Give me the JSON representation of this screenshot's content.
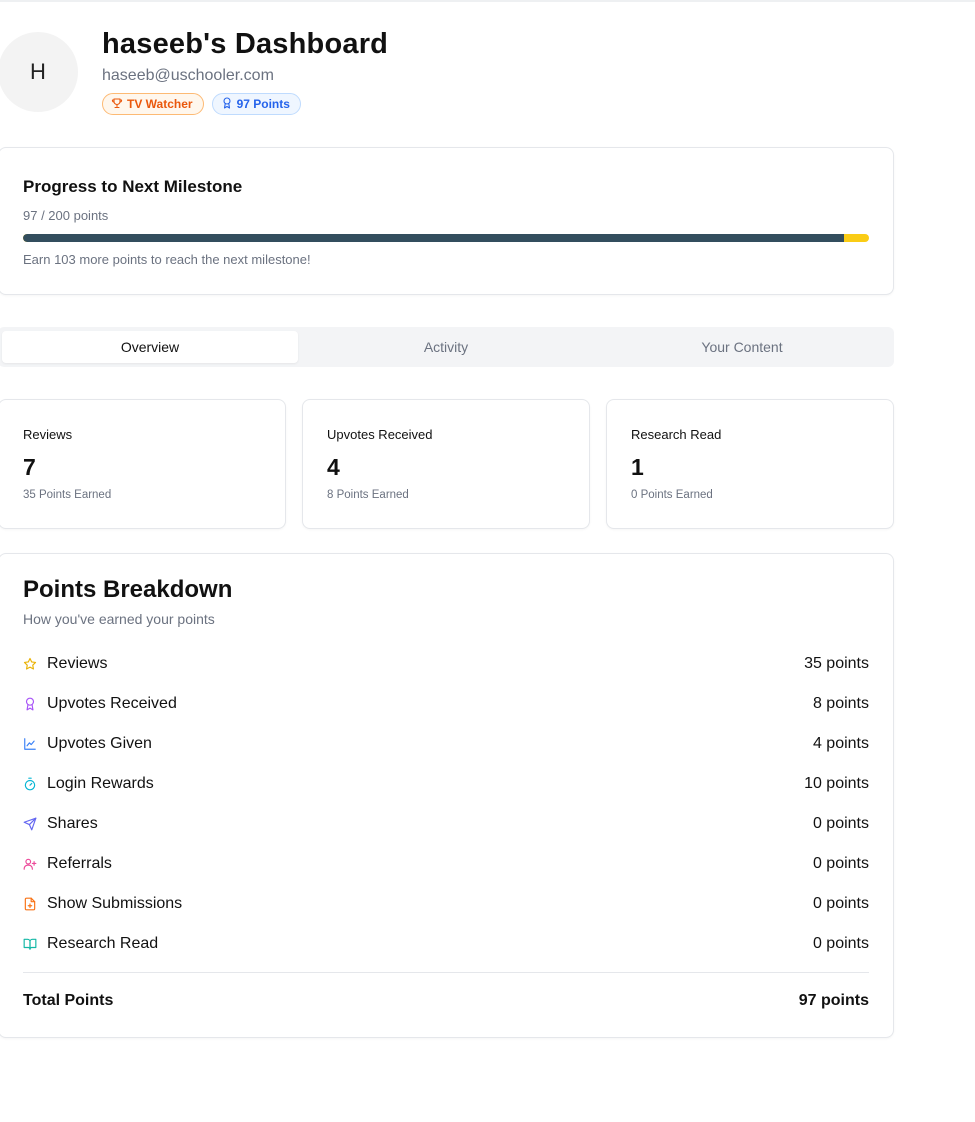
{
  "header": {
    "avatar_initial": "H",
    "title": "haseeb's Dashboard",
    "email": "haseeb@uschooler.com",
    "badges": [
      {
        "label": "TV Watcher",
        "icon": "trophy-icon",
        "color": "#ea580c"
      },
      {
        "label": "97 Points",
        "icon": "award-icon",
        "color": "#2563eb"
      }
    ]
  },
  "progress": {
    "title": "Progress to Next Milestone",
    "points_text": "97 / 200 points",
    "current": 97,
    "target": 200,
    "fraction": 0.97,
    "message": "Earn 103 more points to reach the next milestone!",
    "fill_color": "#334e5e",
    "track_color": "#facc15"
  },
  "tabs": [
    {
      "label": "Overview",
      "active": true
    },
    {
      "label": "Activity",
      "active": false
    },
    {
      "label": "Your Content",
      "active": false
    }
  ],
  "stats": [
    {
      "label": "Reviews",
      "value": "7",
      "sub": "35 Points Earned"
    },
    {
      "label": "Upvotes Received",
      "value": "4",
      "sub": "8 Points Earned"
    },
    {
      "label": "Research Read",
      "value": "1",
      "sub": "0 Points Earned"
    }
  ],
  "breakdown": {
    "title": "Points Breakdown",
    "subtitle": "How you've earned your points",
    "items": [
      {
        "name": "Reviews",
        "value": "35 points",
        "icon": "star-icon",
        "color": "#eab308"
      },
      {
        "name": "Upvotes Received",
        "value": "8 points",
        "icon": "award-icon",
        "color": "#a855f7"
      },
      {
        "name": "Upvotes Given",
        "value": "4 points",
        "icon": "trending-up-icon",
        "color": "#3b82f6"
      },
      {
        "name": "Login Rewards",
        "value": "10 points",
        "icon": "timer-icon",
        "color": "#06b6d4"
      },
      {
        "name": "Shares",
        "value": "0 points",
        "icon": "send-icon",
        "color": "#6366f1"
      },
      {
        "name": "Referrals",
        "value": "0 points",
        "icon": "user-plus-icon",
        "color": "#ec4899"
      },
      {
        "name": "Show Submissions",
        "value": "0 points",
        "icon": "file-plus-icon",
        "color": "#f97316"
      },
      {
        "name": "Research Read",
        "value": "0 points",
        "icon": "book-open-icon",
        "color": "#14b8a6"
      }
    ],
    "total_label": "Total Points",
    "total_value": "97 points"
  }
}
